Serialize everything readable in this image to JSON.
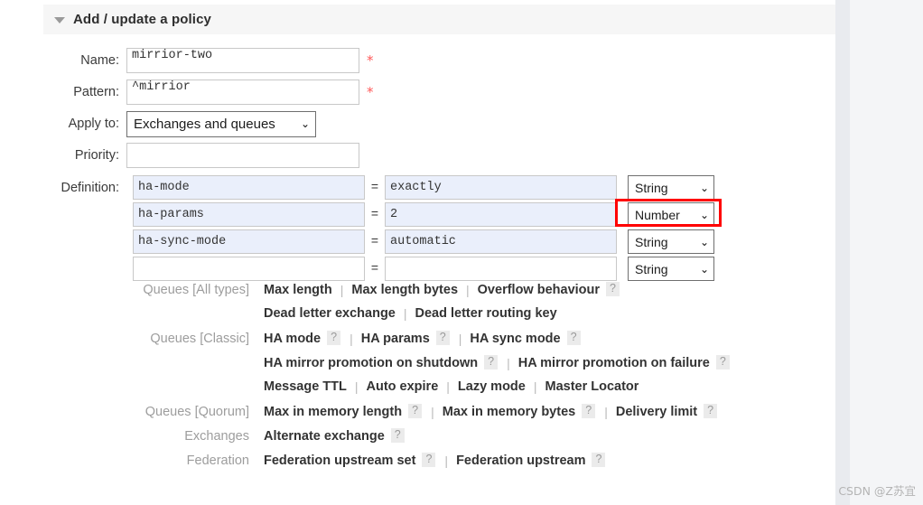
{
  "section": {
    "title": "Add / update a policy",
    "caret_icon": "triangle-down-icon"
  },
  "form": {
    "name": {
      "label": "Name:",
      "value": "mirrior-two",
      "required_marker": "*"
    },
    "pattern": {
      "label": "Pattern:",
      "value": "^mirrior",
      "required_marker": "*"
    },
    "apply_to": {
      "label": "Apply to:",
      "selected": "Exchanges and queues",
      "chevron": "⌄"
    },
    "priority": {
      "label": "Priority:",
      "value": ""
    },
    "definition": {
      "label": "Definition:",
      "equals": "=",
      "chevron": "⌄",
      "rows": [
        {
          "key": "ha-mode",
          "value": "exactly",
          "type": "String"
        },
        {
          "key": "ha-params",
          "value": "2",
          "type": "Number"
        },
        {
          "key": "ha-sync-mode",
          "value": "automatic",
          "type": "String"
        },
        {
          "key": "",
          "value": "",
          "type": "String"
        }
      ],
      "highlight_color": "#ff0000",
      "highlighted_row_index": 1
    }
  },
  "shortcut_groups": [
    {
      "category": "Queues [All types]",
      "lines": [
        [
          {
            "text": "Max length",
            "help": false
          },
          {
            "text": "Max length bytes",
            "help": false
          },
          {
            "text": "Overflow behaviour",
            "help": true
          }
        ],
        [
          {
            "text": "Dead letter exchange",
            "help": false
          },
          {
            "text": "Dead letter routing key",
            "help": false
          }
        ]
      ]
    },
    {
      "category": "Queues [Classic]",
      "lines": [
        [
          {
            "text": "HA mode",
            "help": true
          },
          {
            "text": "HA params",
            "help": true
          },
          {
            "text": "HA sync mode",
            "help": true
          }
        ],
        [
          {
            "text": "HA mirror promotion on shutdown",
            "help": true
          },
          {
            "text": "HA mirror promotion on failure",
            "help": true
          }
        ],
        [
          {
            "text": "Message TTL",
            "help": false
          },
          {
            "text": "Auto expire",
            "help": false
          },
          {
            "text": "Lazy mode",
            "help": false
          },
          {
            "text": "Master Locator",
            "help": false
          }
        ]
      ]
    },
    {
      "category": "Queues [Quorum]",
      "lines": [
        [
          {
            "text": "Max in memory length",
            "help": true
          },
          {
            "text": "Max in memory bytes",
            "help": true
          },
          {
            "text": "Delivery limit",
            "help": true
          }
        ]
      ]
    },
    {
      "category": "Exchanges",
      "lines": [
        [
          {
            "text": "Alternate exchange",
            "help": true
          }
        ]
      ]
    },
    {
      "category": "Federation",
      "lines": [
        [
          {
            "text": "Federation upstream set",
            "help": true
          },
          {
            "text": "Federation upstream",
            "help": true
          }
        ]
      ]
    }
  ],
  "help_glyph": "?",
  "separator": "|",
  "watermark": "CSDN @Z苏宜"
}
